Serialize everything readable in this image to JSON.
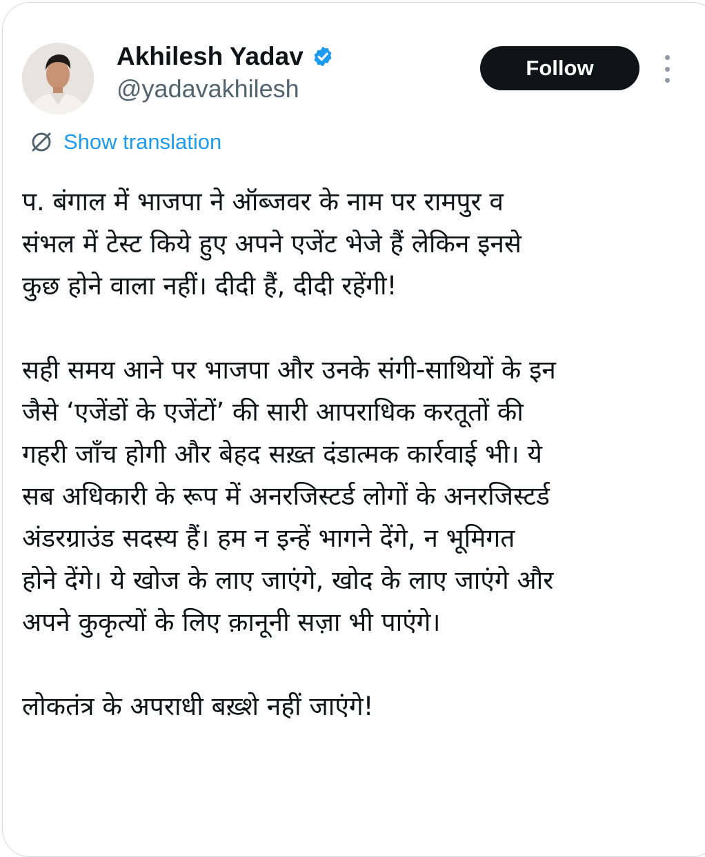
{
  "author": {
    "display_name": "Akhilesh Yadav",
    "handle": "@yadavakhilesh",
    "verified": true,
    "verified_icon": "verified-badge-icon",
    "avatar": "profile-photo"
  },
  "actions": {
    "follow_label": "Follow",
    "more_icon": "vertical-ellipsis-icon"
  },
  "translation": {
    "label": "Show translation",
    "icon": "translate-icon"
  },
  "tweet": {
    "paragraphs": [
      [
        "प. बंगाल में भाजपा ने ऑब्जवर के नाम पर रामपुर व",
        "संभल में टेस्ट किये हुए अपने एजेंट भेजे हैं लेकिन इनसे",
        "कुछ होने वाला नहीं। दीदी हैं, दीदी रहेंगी!"
      ],
      [
        "सही समय आने पर भाजपा और उनके संगी-साथियों के इन",
        "जैसे ‘एजेंडों के एजेंटों’ की सारी आपराधिक करतूतों की",
        "गहरी जाँच होगी और बेहद सख़्त दंडात्मक कार्रवाई भी। ये",
        "सब अधिकारी के रूप में अनरजिस्टर्ड लोगों के अनरजिस्टर्ड",
        "अंडरग्राउंड सदस्य हैं। हम न इन्हें भागने देंगे, न भूमिगत",
        "होने देंगे। ये खोज के लाए जाएंगे, खोद के लाए जाएंगे और",
        "अपने कुकृत्यों के लिए क़ानूनी सज़ा भी पाएंगे।"
      ],
      [
        "लोकतंत्र के अपराधी बख़्शे नहीं जाएंगे!"
      ]
    ]
  },
  "colors": {
    "text_primary": "#0f1419",
    "text_secondary": "#536471",
    "link": "#1d9bf0",
    "verified": "#1d9bf0",
    "follow_bg": "#0f1419",
    "follow_text": "#ffffff"
  }
}
